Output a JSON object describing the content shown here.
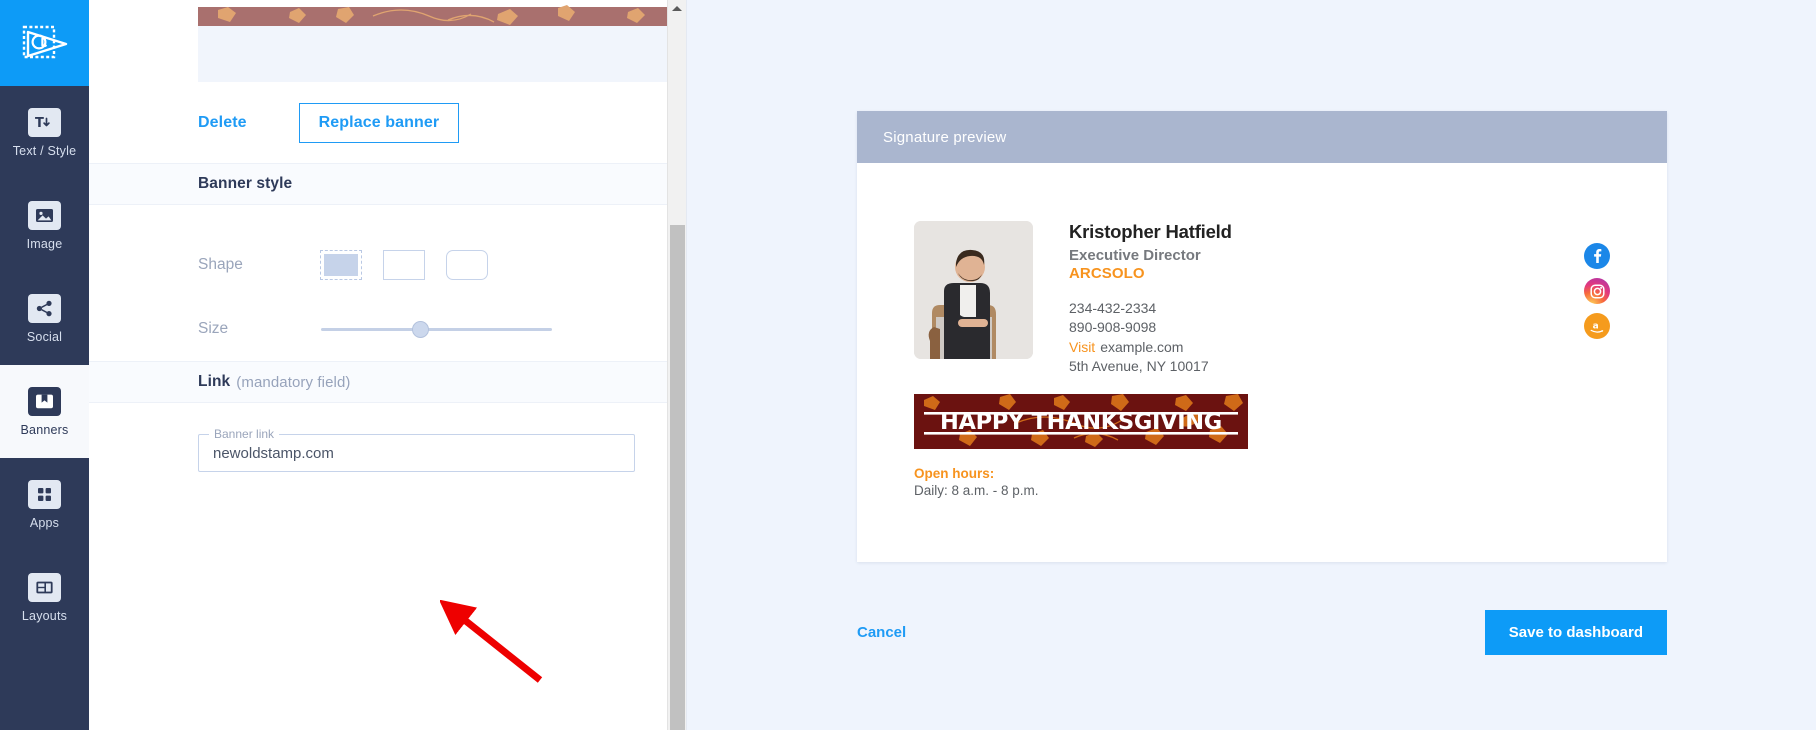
{
  "sidebar": {
    "logo_icon": "envelope-at-logo-icon",
    "items": [
      {
        "label": "Text / Style",
        "icon": "text-style-icon",
        "active": false
      },
      {
        "label": "Image",
        "icon": "image-icon",
        "active": false
      },
      {
        "label": "Social",
        "icon": "share-social-icon",
        "active": false
      },
      {
        "label": "Banners",
        "icon": "bookmark-banner-icon",
        "active": true
      },
      {
        "label": "Apps",
        "icon": "grid-apps-icon",
        "active": false
      },
      {
        "label": "Layouts",
        "icon": "layouts-icon",
        "active": false
      }
    ]
  },
  "editor": {
    "delete_label": "Delete",
    "replace_label": "Replace banner",
    "banner_style_heading": "Banner style",
    "shape_label": "Shape",
    "shape_options": [
      "rectangle-selected",
      "rectangle-square",
      "rectangle-rounded"
    ],
    "shape_selected_index": 0,
    "size_label": "Size",
    "size_value_percent": 43,
    "link_heading": "Link",
    "link_heading_note": "(mandatory field)",
    "banner_link_legend": "Banner link",
    "banner_link_value": "newoldstamp.com",
    "banner_link_placeholder": "Banner link"
  },
  "preview": {
    "header_title": "Signature preview",
    "signature": {
      "name": "Kristopher Hatfield",
      "role": "Executive Director",
      "company": "ARCSOLO",
      "phone_1": "234-432-2334",
      "phone_2": "890-908-9098",
      "visit_label": "Visit",
      "website": "example.com",
      "address": "5th Avenue, NY 10017",
      "banner_text": "HAPPY THANKSGIVING",
      "hours_title": "Open hours:",
      "hours_value": "Daily: 8 a.m. - 8 p.m.",
      "socials": [
        {
          "name": "facebook-icon",
          "color": "#1b87e8"
        },
        {
          "name": "instagram-icon",
          "color": "#e2387e"
        },
        {
          "name": "amazon-icon",
          "color": "#f59b1d"
        }
      ]
    }
  },
  "footer": {
    "cancel_label": "Cancel",
    "save_label": "Save to dashboard"
  },
  "colors": {
    "accent_blue": "#0d9bf7",
    "sidebar_navy": "#2e3a59",
    "preview_bg": "#eff4fd",
    "preview_header": "#aab6cf",
    "brand_orange": "#f7931e",
    "banner_maroon": "#6b1210",
    "annotation_red": "#ee0000"
  }
}
